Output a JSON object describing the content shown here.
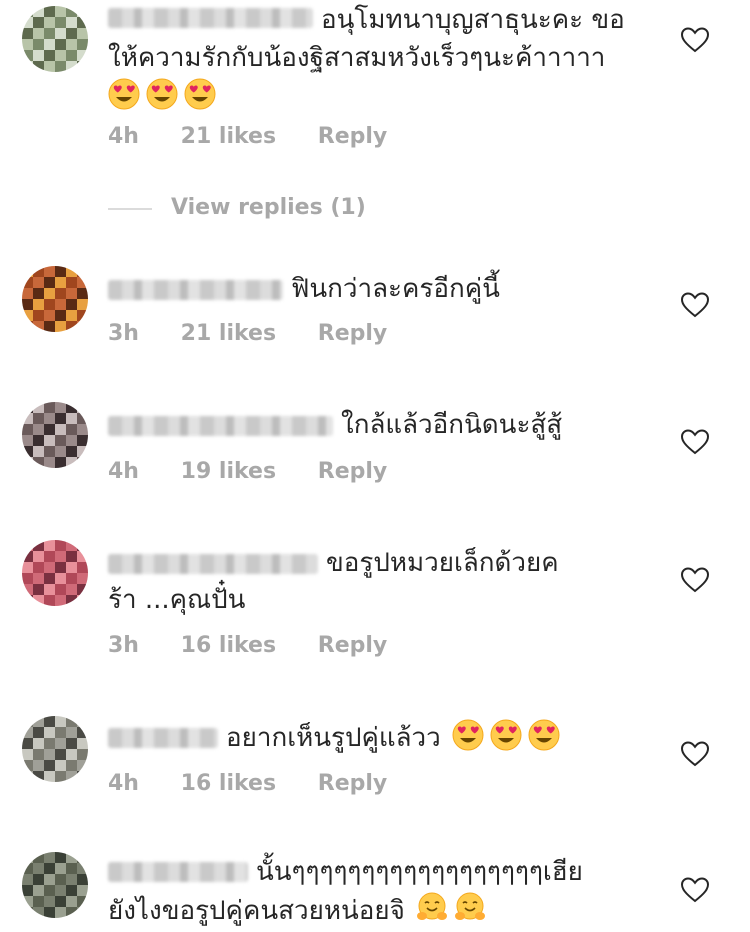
{
  "comments": [
    {
      "text_lines": [
        "อนุโมทนาบุญสาธุนะคะ ขอ",
        "ให้ความรักกับน้องฐิสาสมหวังเร็วๆนะค้าาาาา"
      ],
      "emoji": "heart-eyes-emoji",
      "emoji_count": 3,
      "time": "4h",
      "likes": "21 likes",
      "reply": "Reply",
      "colors": [
        "#7a8a6a",
        "#b8c4a8",
        "#5e6a4e",
        "#d4dccc"
      ]
    },
    {
      "text_lines": [
        "ฟินกว่าละครอีกคู่นี้"
      ],
      "time": "3h",
      "likes": "21 likes",
      "reply": "Reply",
      "colors": [
        "#a0461e",
        "#e8a040",
        "#5a2a14",
        "#c8683a"
      ]
    },
    {
      "text_lines": [
        "ใกล้แล้วอีกนิดนะสู้สู้"
      ],
      "time": "4h",
      "likes": "19 likes",
      "reply": "Reply",
      "colors": [
        "#6a5a5a",
        "#c8bcbc",
        "#3a2e30",
        "#9a8a8a"
      ]
    },
    {
      "text_lines": [
        "ขอรูปหมวยเล็กด้วยค",
        "ร้า ...คุณปั๋น"
      ],
      "time": "3h",
      "likes": "16 likes",
      "reply": "Reply",
      "colors": [
        "#b04858",
        "#e8909a",
        "#7a3040",
        "#d06a78"
      ]
    },
    {
      "text_lines": [
        "อยากเห็นรูปคู่แล้วว"
      ],
      "emoji": "heart-eyes-emoji",
      "emoji_count": 3,
      "time": "4h",
      "likes": "16 likes",
      "reply": "Reply",
      "colors": [
        "#7a7a70",
        "#c8c8c0",
        "#4a4a44",
        "#a0a098"
      ]
    },
    {
      "text_lines": [
        "นั้นๆๆๆๆๆๆๆๆๆๆๆๆๆๆๆๆๆๆเฮีย",
        "ยังไงขอรูปคู่คนสวยหน่อยจิ"
      ],
      "emoji": "hugging-emoji",
      "emoji_count": 2,
      "colors": [
        "#5a6050",
        "#9aa090",
        "#3a4036",
        "#7a8070"
      ]
    }
  ],
  "view_replies": "View replies (1)"
}
